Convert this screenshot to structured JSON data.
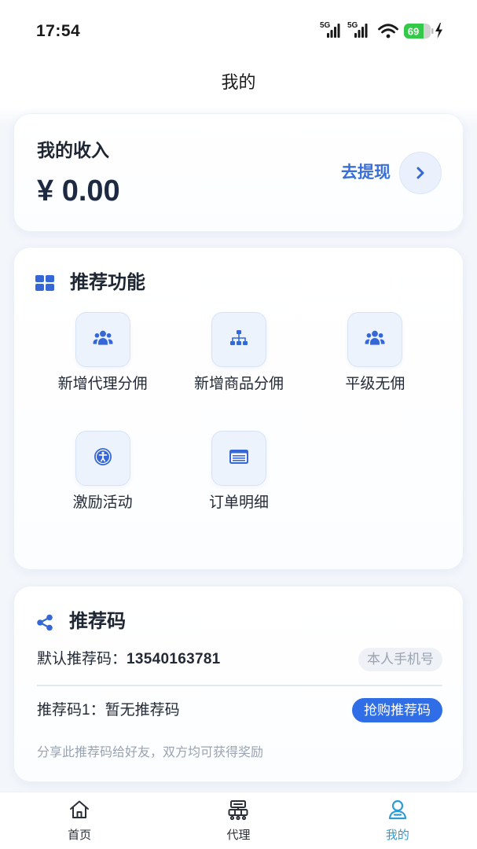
{
  "status_bar": {
    "time": "17:54",
    "network1": "5G",
    "network2": "5G",
    "battery": "69"
  },
  "header": {
    "title": "我的"
  },
  "income": {
    "title": "我的收入",
    "amount": "¥ 0.00",
    "withdraw_label": "去提现",
    "withdraw_icon": "chevron-right-icon"
  },
  "features": {
    "title": "推荐功能",
    "title_icon": "grid-icon",
    "items": [
      {
        "label": "新增代理分佣",
        "icon": "users-icon"
      },
      {
        "label": "新增商品分佣",
        "icon": "sitemap-icon"
      },
      {
        "label": "平级无佣",
        "icon": "users-icon"
      },
      {
        "label": "激励活动",
        "icon": "accessibility-icon"
      },
      {
        "label": "订单明细",
        "icon": "list-window-icon"
      }
    ]
  },
  "referral": {
    "title": "推荐码",
    "title_icon": "share-icon",
    "default_label": "默认推荐码：",
    "default_code": "13540163781",
    "default_badge": "本人手机号",
    "code1_label": "推荐码1：",
    "code1_value": "暂无推荐码",
    "buy_button": "抢购推荐码",
    "note": "分享此推荐码给好友，双方均可获得奖励"
  },
  "tabbar": {
    "items": [
      {
        "label": "首页",
        "icon": "home-icon",
        "active": false
      },
      {
        "label": "代理",
        "icon": "agent-icon",
        "active": false
      },
      {
        "label": "我的",
        "icon": "user-icon",
        "active": true
      }
    ]
  },
  "colors": {
    "accent": "#2f6ee6",
    "accent_text": "#3a6fd6",
    "icon_blue": "#3568d6",
    "tab_active": "#2e9bd6",
    "text_primary": "#1f2633",
    "text_muted": "#9aa3b1",
    "battery_fill": "#35c94a",
    "page_background": "#f3f6fb"
  }
}
